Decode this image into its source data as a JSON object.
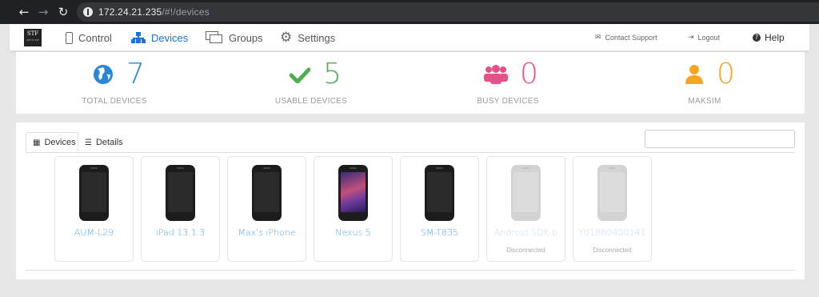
{
  "browser": {
    "url_host": "172.24.21.235",
    "url_path": "/#!/devices"
  },
  "nav": {
    "logo_text": "STF",
    "logo_sub": "OPEN STF",
    "items": [
      {
        "label": "Control",
        "icon": "phone-icon"
      },
      {
        "label": "Devices",
        "icon": "sitemap-icon",
        "active": true
      },
      {
        "label": "Groups",
        "icon": "groups-icon"
      },
      {
        "label": "Settings",
        "icon": "gear-icon"
      }
    ],
    "contact_support": "Contact Support",
    "logout": "Logout",
    "help": "Help"
  },
  "stats": [
    {
      "count": "7",
      "label": "TOTAL DEVICES",
      "icon": "globe-icon",
      "color": "#2a86d6"
    },
    {
      "count": "5",
      "label": "USABLE DEVICES",
      "icon": "check-icon",
      "color": "#4caf50"
    },
    {
      "count": "0",
      "label": "BUSY DEVICES",
      "icon": "users-icon",
      "color": "#e8508c"
    },
    {
      "count": "0",
      "label": "MAKSIM",
      "icon": "user-icon",
      "color": "#f5a623"
    }
  ],
  "tabs": {
    "devices": "Devices",
    "details": "Details"
  },
  "search": {
    "value": "",
    "placeholder": ""
  },
  "devices": [
    {
      "name": "AUM-L29",
      "status": ""
    },
    {
      "name": "iPad 13.1.3",
      "status": ""
    },
    {
      "name": "Max's iPhone",
      "status": ""
    },
    {
      "name": "Nexus 5",
      "status": ""
    },
    {
      "name": "SM-T835",
      "status": ""
    },
    {
      "name": "Android SDK b",
      "status": "Disconnected"
    },
    {
      "name": "Y01BB0400141",
      "status": "Disconnected"
    }
  ],
  "colors": {
    "accent": "#1a73d6",
    "link": "#5aa6e6"
  }
}
